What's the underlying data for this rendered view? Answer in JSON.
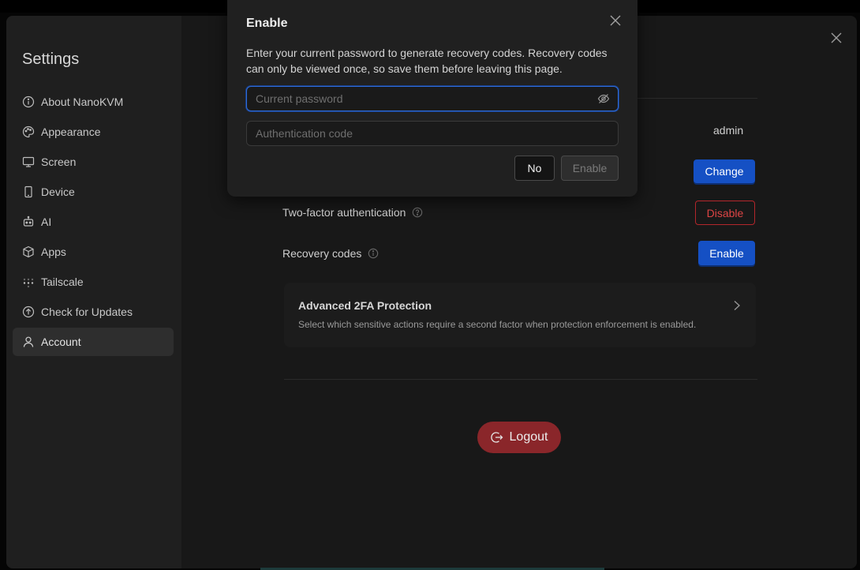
{
  "sidebar": {
    "title": "Settings",
    "items": [
      {
        "label": "About NanoKVM",
        "icon": "info-circle-icon"
      },
      {
        "label": "Appearance",
        "icon": "palette-icon"
      },
      {
        "label": "Screen",
        "icon": "monitor-icon"
      },
      {
        "label": "Device",
        "icon": "phone-device-icon"
      },
      {
        "label": "AI",
        "icon": "robot-icon"
      },
      {
        "label": "Apps",
        "icon": "package-box-icon"
      },
      {
        "label": "Tailscale",
        "icon": "tailscale-dots-icon"
      },
      {
        "label": "Check for Updates",
        "icon": "arrow-up-circle-icon"
      },
      {
        "label": "Account",
        "icon": "user-icon",
        "active": true
      }
    ]
  },
  "account": {
    "username": "admin",
    "change_label": "Change",
    "two_factor_label": "Two-factor authentication",
    "disable_label": "Disable",
    "recovery_label": "Recovery codes",
    "recovery_enable_label": "Enable",
    "advanced_title": "Advanced 2FA Protection",
    "advanced_desc": "Select which sensitive actions require a second factor when protection enforcement is enabled.",
    "logout_label": "Logout"
  },
  "dialog": {
    "title": "Enable",
    "description": "Enter your current password to generate recovery codes. Recovery codes can only be viewed once, so save them before leaving this page.",
    "password_placeholder": "Current password",
    "code_placeholder": "Authentication code",
    "no_label": "No",
    "enable_label": "Enable"
  },
  "colors": {
    "accent_blue": "#1550c4",
    "danger_red": "#b3262b",
    "logout_red": "#8a262a"
  }
}
